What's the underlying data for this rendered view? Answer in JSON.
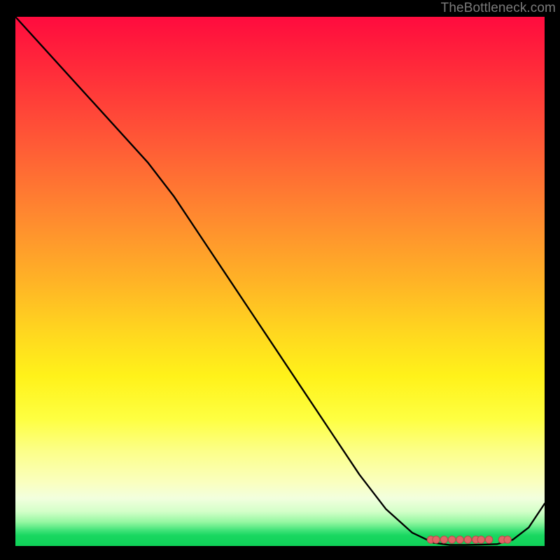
{
  "watermark": "TheBottleneck.com",
  "colors": {
    "line": "#000000",
    "marker_fill": "#e06666",
    "marker_stroke": "#b84a4a",
    "background": "#000000"
  },
  "chart_data": {
    "type": "line",
    "title": "",
    "xlabel": "",
    "ylabel": "",
    "xlim": [
      0,
      100
    ],
    "ylim": [
      0,
      100
    ],
    "grid": false,
    "legend": false,
    "x": [
      0,
      5,
      10,
      15,
      20,
      25,
      30,
      35,
      40,
      45,
      50,
      55,
      60,
      65,
      70,
      75,
      79,
      82,
      85,
      88,
      91,
      94,
      97,
      100
    ],
    "values": [
      100,
      94.5,
      89,
      83.5,
      78,
      72.5,
      66,
      58.5,
      51,
      43.5,
      36,
      28.5,
      21,
      13.5,
      7,
      2.5,
      0.6,
      0.2,
      0.2,
      0.25,
      0.35,
      1.2,
      3.5,
      8
    ],
    "markers": {
      "y": 1.2,
      "x_values": [
        78.5,
        79.5,
        81,
        82.5,
        84,
        85.5,
        87,
        88,
        89.5,
        92,
        93
      ]
    }
  }
}
